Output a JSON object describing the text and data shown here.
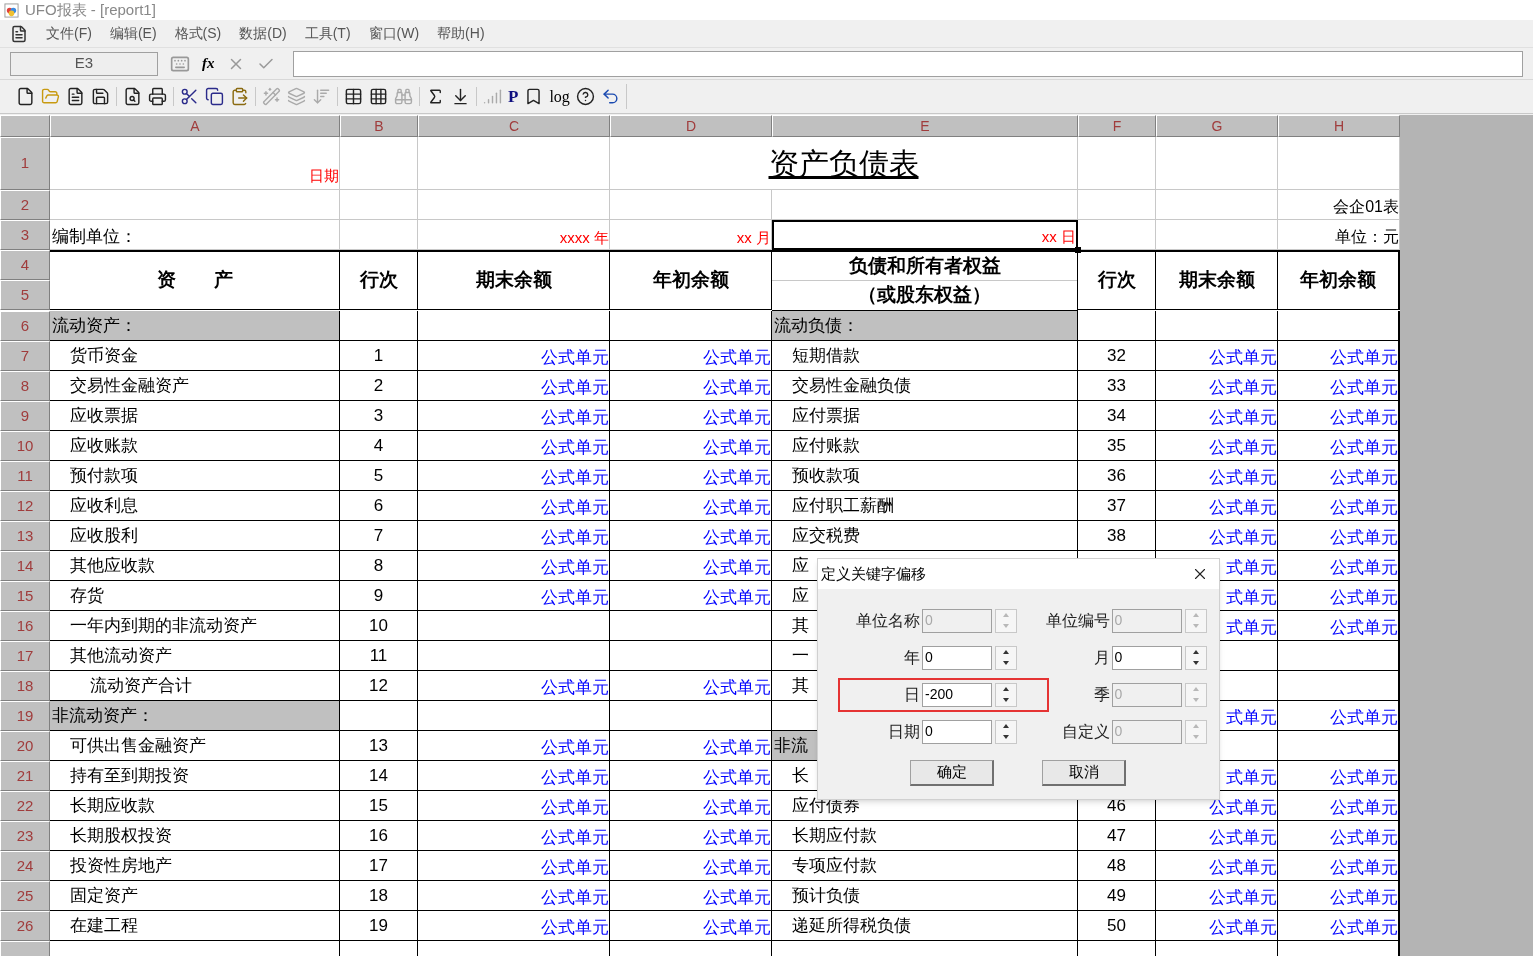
{
  "window": {
    "title": "UFO报表 - [report1]"
  },
  "menu": [
    "文件(F)",
    "编辑(E)",
    "格式(S)",
    "数据(D)",
    "工具(T)",
    "窗口(W)",
    "帮助(H)"
  ],
  "formula_bar": {
    "cell": "E3",
    "fx": "fx"
  },
  "toolbar": {
    "glyphs": [
      "P",
      "log"
    ]
  },
  "sheet": {
    "columns": [
      "A",
      "B",
      "C",
      "D",
      "E",
      "F",
      "G",
      "H"
    ],
    "title_row": {
      "number": "1",
      "date_label": "日期",
      "title": "资产负债表"
    },
    "form_row": {
      "number": "2",
      "form_code": "会企01表"
    },
    "unit_row": {
      "number": "3",
      "unit_label": "编制单位：",
      "year": "xxxx 年",
      "month": "xx 月",
      "day": "xx 日",
      "day_selected": true,
      "currency": "单位：元"
    },
    "header": {
      "numbers": [
        "4",
        "5"
      ],
      "asset": "资　　产",
      "line": "行次",
      "end": "期末余额",
      "start": "年初余额",
      "liability": [
        "负债和所有者权益",
        "（或股东权益）"
      ],
      "line2": "行次",
      "end2": "期末余额",
      "start2": "年初余额"
    },
    "rows": [
      {
        "number": "6",
        "asset": {
          "text": "流动资产：",
          "kind": "section"
        },
        "liability": {
          "text": "流动负债：",
          "kind": "section"
        }
      },
      {
        "number": "7",
        "asset": {
          "text": "货币资金",
          "kind": "item"
        },
        "line": "1",
        "end": "公式单元",
        "start": "公式单元",
        "liability": {
          "text": "短期借款",
          "kind": "item"
        },
        "line2": "32",
        "end2": "公式单元",
        "start2": "公式单元"
      },
      {
        "number": "8",
        "asset": {
          "text": "交易性金融资产",
          "kind": "item"
        },
        "line": "2",
        "end": "公式单元",
        "start": "公式单元",
        "liability": {
          "text": "交易性金融负债",
          "kind": "item"
        },
        "line2": "33",
        "end2": "公式单元",
        "start2": "公式单元"
      },
      {
        "number": "9",
        "asset": {
          "text": "应收票据",
          "kind": "item"
        },
        "line": "3",
        "end": "公式单元",
        "start": "公式单元",
        "liability": {
          "text": "应付票据",
          "kind": "item"
        },
        "line2": "34",
        "end2": "公式单元",
        "start2": "公式单元"
      },
      {
        "number": "10",
        "asset": {
          "text": "应收账款",
          "kind": "item"
        },
        "line": "4",
        "end": "公式单元",
        "start": "公式单元",
        "liability": {
          "text": "应付账款",
          "kind": "item"
        },
        "line2": "35",
        "end2": "公式单元",
        "start2": "公式单元"
      },
      {
        "number": "11",
        "asset": {
          "text": "预付款项",
          "kind": "item"
        },
        "line": "5",
        "end": "公式单元",
        "start": "公式单元",
        "liability": {
          "text": "预收款项",
          "kind": "item"
        },
        "line2": "36",
        "end2": "公式单元",
        "start2": "公式单元"
      },
      {
        "number": "12",
        "asset": {
          "text": "应收利息",
          "kind": "item"
        },
        "line": "6",
        "end": "公式单元",
        "start": "公式单元",
        "liability": {
          "text": "应付职工薪酬",
          "kind": "item"
        },
        "line2": "37",
        "end2": "公式单元",
        "start2": "公式单元"
      },
      {
        "number": "13",
        "asset": {
          "text": "应收股利",
          "kind": "item"
        },
        "line": "7",
        "end": "公式单元",
        "start": "公式单元",
        "liability": {
          "text": "应交税费",
          "kind": "item"
        },
        "line2": "38",
        "end2": "公式单元",
        "start2": "公式单元"
      },
      {
        "number": "14",
        "asset": {
          "text": "其他应收款",
          "kind": "item"
        },
        "line": "8",
        "end": "公式单元",
        "start": "公式单元",
        "liability": {
          "text": "应",
          "kind": "item"
        },
        "end2": "式单元",
        "start2": "公式单元"
      },
      {
        "number": "15",
        "asset": {
          "text": "存货",
          "kind": "item"
        },
        "line": "9",
        "end": "公式单元",
        "start": "公式单元",
        "liability": {
          "text": "应",
          "kind": "item"
        },
        "end2": "式单元",
        "start2": "公式单元"
      },
      {
        "number": "16",
        "asset": {
          "text": "一年内到期的非流动资产",
          "kind": "item"
        },
        "line": "10",
        "liability": {
          "text": "其",
          "kind": "item"
        },
        "end2": "式单元",
        "start2": "公式单元"
      },
      {
        "number": "17",
        "asset": {
          "text": "其他流动资产",
          "kind": "item"
        },
        "line": "11",
        "liability": {
          "text": "一",
          "kind": "item"
        }
      },
      {
        "number": "18",
        "asset": {
          "text": "流动资产合计",
          "kind": "total"
        },
        "line": "12",
        "end": "公式单元",
        "start": "公式单元",
        "liability": {
          "text": "其",
          "kind": "item"
        }
      },
      {
        "number": "19",
        "asset": {
          "text": "非流动资产：",
          "kind": "section"
        },
        "end2": "式单元",
        "start2": "公式单元"
      },
      {
        "number": "20",
        "asset": {
          "text": "可供出售金融资产",
          "kind": "item"
        },
        "line": "13",
        "end": "公式单元",
        "start": "公式单元",
        "liability": {
          "text": "非流",
          "kind": "section"
        }
      },
      {
        "number": "21",
        "asset": {
          "text": "持有至到期投资",
          "kind": "item"
        },
        "line": "14",
        "end": "公式单元",
        "start": "公式单元",
        "liability": {
          "text": "长",
          "kind": "item"
        },
        "end2": "式单元",
        "start2": "公式单元"
      },
      {
        "number": "22",
        "asset": {
          "text": "长期应收款",
          "kind": "item"
        },
        "line": "15",
        "end": "公式单元",
        "start": "公式单元",
        "liability": {
          "text": "应付债券",
          "kind": "item"
        },
        "line2": "46",
        "end2": "公式单元",
        "start2": "公式单元"
      },
      {
        "number": "23",
        "asset": {
          "text": "长期股权投资",
          "kind": "item"
        },
        "line": "16",
        "end": "公式单元",
        "start": "公式单元",
        "liability": {
          "text": "长期应付款",
          "kind": "item"
        },
        "line2": "47",
        "end2": "公式单元",
        "start2": "公式单元"
      },
      {
        "number": "24",
        "asset": {
          "text": "投资性房地产",
          "kind": "item"
        },
        "line": "17",
        "end": "公式单元",
        "start": "公式单元",
        "liability": {
          "text": "专项应付款",
          "kind": "item"
        },
        "line2": "48",
        "end2": "公式单元",
        "start2": "公式单元"
      },
      {
        "number": "25",
        "asset": {
          "text": "固定资产",
          "kind": "item"
        },
        "line": "18",
        "end": "公式单元",
        "start": "公式单元",
        "liability": {
          "text": "预计负债",
          "kind": "item"
        },
        "line2": "49",
        "end2": "公式单元",
        "start2": "公式单元"
      },
      {
        "number": "26",
        "asset": {
          "text": "在建工程",
          "kind": "item"
        },
        "line": "19",
        "end": "公式单元",
        "start": "公式单元",
        "liability": {
          "text": "递延所得税负债",
          "kind": "item"
        },
        "line2": "50",
        "end2": "公式单元",
        "start2": "公式单元"
      }
    ]
  },
  "dialog": {
    "title": "定义关键字偏移",
    "fields": [
      {
        "label": "单位名称",
        "value": "0",
        "disabled": true,
        "highlighted": false
      },
      {
        "label": "单位编号",
        "value": "0",
        "disabled": true,
        "highlighted": false
      },
      {
        "label": "年",
        "value": "0",
        "disabled": false,
        "highlighted": false
      },
      {
        "label": "月",
        "value": "0",
        "disabled": false,
        "highlighted": false
      },
      {
        "label": "日",
        "value": "-200",
        "disabled": false,
        "highlighted": true
      },
      {
        "label": "季",
        "value": "0",
        "disabled": true,
        "highlighted": false
      },
      {
        "label": "日期",
        "value": "0",
        "disabled": false,
        "highlighted": false
      },
      {
        "label": "自定义",
        "value": "0",
        "disabled": true,
        "highlighted": false
      }
    ],
    "buttons": [
      "确定",
      "取消"
    ]
  }
}
